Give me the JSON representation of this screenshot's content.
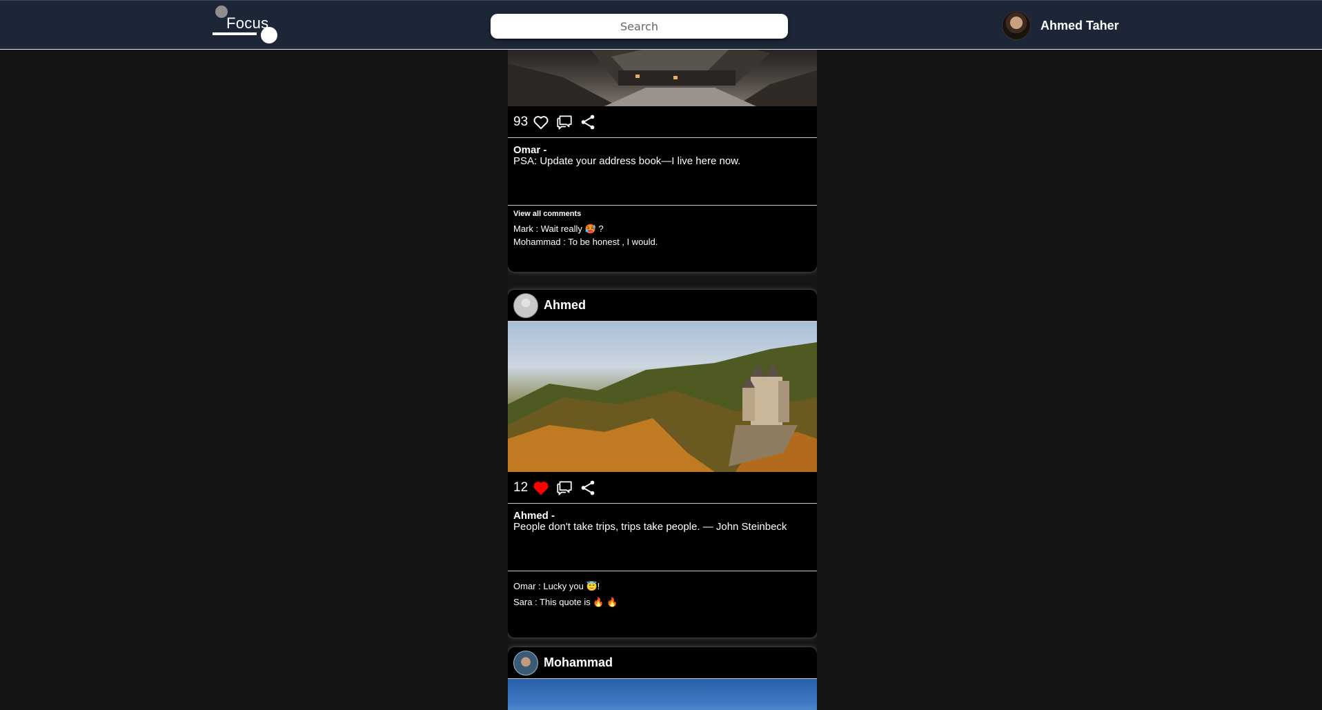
{
  "header": {
    "logo_text": "Focus",
    "search_placeholder": "Search",
    "user_name": "Ahmed Taher"
  },
  "posts": [
    {
      "author": "Omar",
      "image_desc": "snowy-japanese-village-night",
      "likes": "93",
      "liked": false,
      "caption_author": "Omar -",
      "caption": "PSA: Update your address book—I live here now.",
      "view_all_label": "View all comments",
      "comments": [
        "Mark : Wait really 🥵 ?",
        "Mohammad : To be honest , I would."
      ]
    },
    {
      "author": "Ahmed",
      "image_desc": "castle-in-autumn-forest",
      "likes": "12",
      "liked": true,
      "caption_author": "Ahmed -",
      "caption": "People don't take trips, trips take people. — John Steinbeck",
      "comments": [
        "Omar : Lucky you 😇!",
        "Sara : This quote is 🔥 🔥"
      ]
    },
    {
      "author": "Mohammad",
      "image_desc": "blue-sky"
    }
  ],
  "colors": {
    "topbar": "#1c2636",
    "page_bg": "#151515",
    "card_bg": "#000000",
    "like_active": "#ff0000"
  },
  "icons": [
    "heart-icon",
    "comment-icon",
    "share-icon"
  ]
}
